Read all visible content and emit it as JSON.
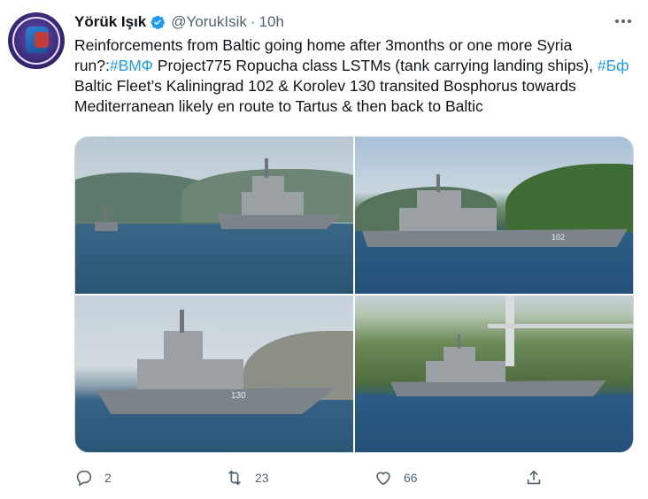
{
  "tweet": {
    "author_name": "Yörük Işık",
    "handle": "@YorukIsik",
    "separator": "·",
    "time": "10h",
    "text": {
      "part1": "Reinforcements from Baltic going home after 3months or one more Syria run?:",
      "tag1": "#ВМФ",
      "part2": " Project775 Ropucha class LSTMs (tank carrying landing ships), ",
      "tag2": "#Бф",
      "part3": " Baltic Fleet’s Kaliningrad 102 & Korolev 130 transited Bosphorus towards Mediterranean likely en route to Tartus & then back to Baltic"
    },
    "media": {
      "photos": [
        {
          "label": "",
          "hull_number": ""
        },
        {
          "label": "",
          "hull_number": "102"
        },
        {
          "label": "",
          "hull_number": "130"
        },
        {
          "label": "",
          "hull_number": ""
        }
      ]
    },
    "actions": {
      "reply_count": "2",
      "retweet_count": "23",
      "like_count": "66",
      "share_count": ""
    }
  },
  "icons": {
    "verified": "verified-badge-icon",
    "more": "more-icon",
    "reply": "reply-icon",
    "retweet": "retweet-icon",
    "like": "heart-icon",
    "share": "share-icon"
  },
  "colors": {
    "accent": "#1d9bf0",
    "text": "#0f1419",
    "muted": "#536471",
    "border": "#cfd9de"
  }
}
